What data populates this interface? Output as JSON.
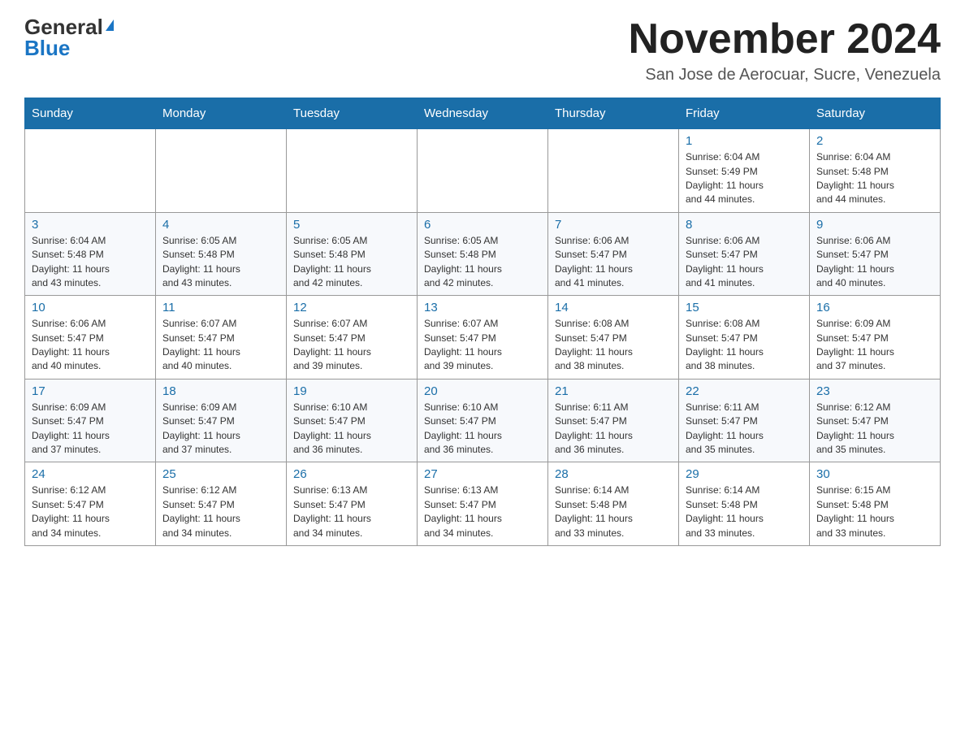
{
  "header": {
    "logo_general": "General",
    "logo_blue": "Blue",
    "month_title": "November 2024",
    "location": "San Jose de Aerocuar, Sucre, Venezuela"
  },
  "days_of_week": [
    "Sunday",
    "Monday",
    "Tuesday",
    "Wednesday",
    "Thursday",
    "Friday",
    "Saturday"
  ],
  "weeks": [
    [
      {
        "day": "",
        "info": ""
      },
      {
        "day": "",
        "info": ""
      },
      {
        "day": "",
        "info": ""
      },
      {
        "day": "",
        "info": ""
      },
      {
        "day": "",
        "info": ""
      },
      {
        "day": "1",
        "info": "Sunrise: 6:04 AM\nSunset: 5:49 PM\nDaylight: 11 hours\nand 44 minutes."
      },
      {
        "day": "2",
        "info": "Sunrise: 6:04 AM\nSunset: 5:48 PM\nDaylight: 11 hours\nand 44 minutes."
      }
    ],
    [
      {
        "day": "3",
        "info": "Sunrise: 6:04 AM\nSunset: 5:48 PM\nDaylight: 11 hours\nand 43 minutes."
      },
      {
        "day": "4",
        "info": "Sunrise: 6:05 AM\nSunset: 5:48 PM\nDaylight: 11 hours\nand 43 minutes."
      },
      {
        "day": "5",
        "info": "Sunrise: 6:05 AM\nSunset: 5:48 PM\nDaylight: 11 hours\nand 42 minutes."
      },
      {
        "day": "6",
        "info": "Sunrise: 6:05 AM\nSunset: 5:48 PM\nDaylight: 11 hours\nand 42 minutes."
      },
      {
        "day": "7",
        "info": "Sunrise: 6:06 AM\nSunset: 5:47 PM\nDaylight: 11 hours\nand 41 minutes."
      },
      {
        "day": "8",
        "info": "Sunrise: 6:06 AM\nSunset: 5:47 PM\nDaylight: 11 hours\nand 41 minutes."
      },
      {
        "day": "9",
        "info": "Sunrise: 6:06 AM\nSunset: 5:47 PM\nDaylight: 11 hours\nand 40 minutes."
      }
    ],
    [
      {
        "day": "10",
        "info": "Sunrise: 6:06 AM\nSunset: 5:47 PM\nDaylight: 11 hours\nand 40 minutes."
      },
      {
        "day": "11",
        "info": "Sunrise: 6:07 AM\nSunset: 5:47 PM\nDaylight: 11 hours\nand 40 minutes."
      },
      {
        "day": "12",
        "info": "Sunrise: 6:07 AM\nSunset: 5:47 PM\nDaylight: 11 hours\nand 39 minutes."
      },
      {
        "day": "13",
        "info": "Sunrise: 6:07 AM\nSunset: 5:47 PM\nDaylight: 11 hours\nand 39 minutes."
      },
      {
        "day": "14",
        "info": "Sunrise: 6:08 AM\nSunset: 5:47 PM\nDaylight: 11 hours\nand 38 minutes."
      },
      {
        "day": "15",
        "info": "Sunrise: 6:08 AM\nSunset: 5:47 PM\nDaylight: 11 hours\nand 38 minutes."
      },
      {
        "day": "16",
        "info": "Sunrise: 6:09 AM\nSunset: 5:47 PM\nDaylight: 11 hours\nand 37 minutes."
      }
    ],
    [
      {
        "day": "17",
        "info": "Sunrise: 6:09 AM\nSunset: 5:47 PM\nDaylight: 11 hours\nand 37 minutes."
      },
      {
        "day": "18",
        "info": "Sunrise: 6:09 AM\nSunset: 5:47 PM\nDaylight: 11 hours\nand 37 minutes."
      },
      {
        "day": "19",
        "info": "Sunrise: 6:10 AM\nSunset: 5:47 PM\nDaylight: 11 hours\nand 36 minutes."
      },
      {
        "day": "20",
        "info": "Sunrise: 6:10 AM\nSunset: 5:47 PM\nDaylight: 11 hours\nand 36 minutes."
      },
      {
        "day": "21",
        "info": "Sunrise: 6:11 AM\nSunset: 5:47 PM\nDaylight: 11 hours\nand 36 minutes."
      },
      {
        "day": "22",
        "info": "Sunrise: 6:11 AM\nSunset: 5:47 PM\nDaylight: 11 hours\nand 35 minutes."
      },
      {
        "day": "23",
        "info": "Sunrise: 6:12 AM\nSunset: 5:47 PM\nDaylight: 11 hours\nand 35 minutes."
      }
    ],
    [
      {
        "day": "24",
        "info": "Sunrise: 6:12 AM\nSunset: 5:47 PM\nDaylight: 11 hours\nand 34 minutes."
      },
      {
        "day": "25",
        "info": "Sunrise: 6:12 AM\nSunset: 5:47 PM\nDaylight: 11 hours\nand 34 minutes."
      },
      {
        "day": "26",
        "info": "Sunrise: 6:13 AM\nSunset: 5:47 PM\nDaylight: 11 hours\nand 34 minutes."
      },
      {
        "day": "27",
        "info": "Sunrise: 6:13 AM\nSunset: 5:47 PM\nDaylight: 11 hours\nand 34 minutes."
      },
      {
        "day": "28",
        "info": "Sunrise: 6:14 AM\nSunset: 5:48 PM\nDaylight: 11 hours\nand 33 minutes."
      },
      {
        "day": "29",
        "info": "Sunrise: 6:14 AM\nSunset: 5:48 PM\nDaylight: 11 hours\nand 33 minutes."
      },
      {
        "day": "30",
        "info": "Sunrise: 6:15 AM\nSunset: 5:48 PM\nDaylight: 11 hours\nand 33 minutes."
      }
    ]
  ]
}
